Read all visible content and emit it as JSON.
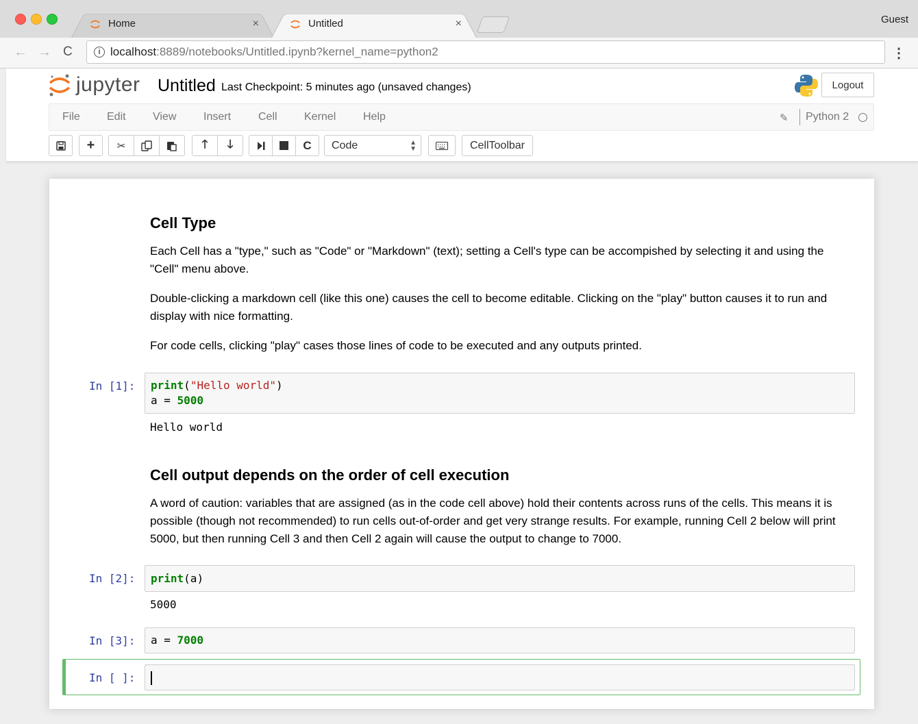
{
  "browser": {
    "tabs": [
      {
        "label": "Home",
        "active": false
      },
      {
        "label": "Untitled",
        "active": true
      }
    ],
    "tab_close": "×",
    "profile": "Guest",
    "url_host": "localhost",
    "url_path": ":8889/notebooks/Untitled.ipynb?kernel_name=python2"
  },
  "jupyter": {
    "logo_text": "jupyter",
    "notebook_name": "Untitled",
    "checkpoint": "Last Checkpoint: 5 minutes ago (unsaved changes)",
    "logout_label": "Logout",
    "menu": [
      "File",
      "Edit",
      "View",
      "Insert",
      "Cell",
      "Kernel",
      "Help"
    ],
    "kernel_name": "Python 2",
    "cell_type_selected": "Code",
    "celltoolbar_label": "CellToolbar"
  },
  "notebook": {
    "md1": {
      "heading": "Cell Type",
      "p1": "Each Cell has a \"type,\" such as \"Code\" or \"Markdown\" (text); setting a Cell's type can be accompished by selecting it and using the \"Cell\" menu above.",
      "p2": "Double-clicking a markdown cell (like this one) causes the cell to become editable. Clicking on the \"play\" button causes it to run and display with nice formatting.",
      "p3": "For code cells, clicking \"play\" cases those lines of code to be executed and any outputs printed."
    },
    "cell1": {
      "prompt": "In [1]:",
      "line1_kw": "print",
      "line1_open": "(",
      "line1_str": "\"Hello world\"",
      "line1_close": ")",
      "line2_lhs": "a = ",
      "line2_num": "5000",
      "output": "Hello world"
    },
    "md2": {
      "heading": "Cell output depends on the order of cell execution",
      "p1": "A word of caution: variables that are assigned (as in the code cell above) hold their contents across runs of the cells. This means it is possible (though not recommended) to run cells out-of-order and get very strange results. For example, running Cell 2 below will print 5000, but then running Cell 3 and then Cell 2 again will cause the output to change to 7000."
    },
    "cell2": {
      "prompt": "In [2]:",
      "kw": "print",
      "rest": "(a)",
      "output": "5000"
    },
    "cell3": {
      "prompt": "In [3]:",
      "lhs": "a = ",
      "num": "7000"
    },
    "cell4": {
      "prompt": "In [ ]:"
    }
  },
  "colors": {
    "prompt": "#303f9f",
    "keyword": "#008000",
    "string": "#ba2121",
    "selected_border": "#66bb6a"
  }
}
